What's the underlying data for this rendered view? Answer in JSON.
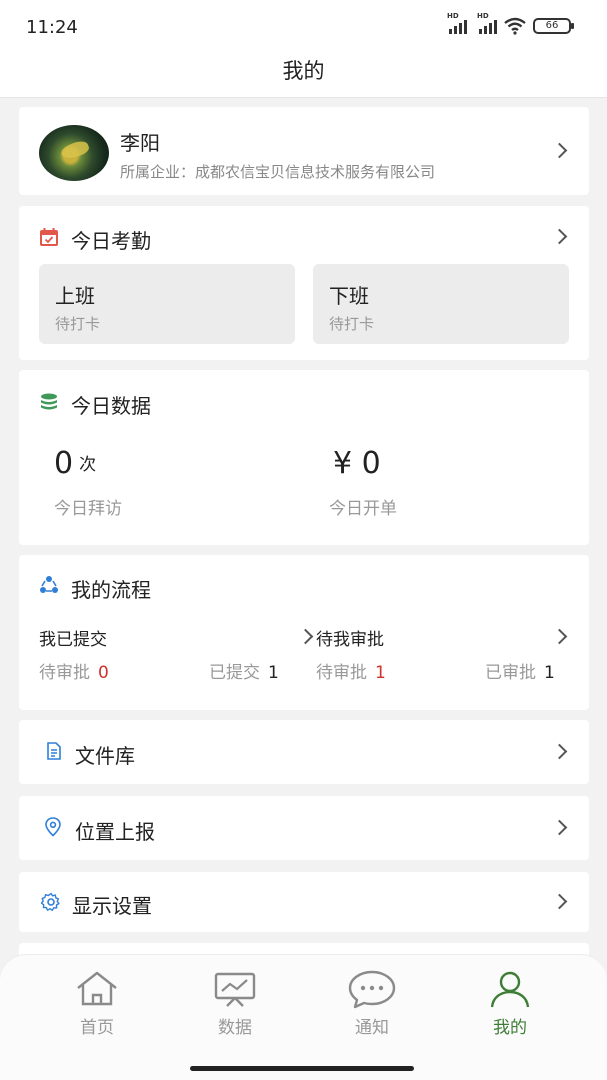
{
  "status_bar": {
    "time": "11:24",
    "signal1_label": "HD",
    "signal2_label": "HD",
    "battery": "66"
  },
  "nav": {
    "title": "我的"
  },
  "profile": {
    "name": "李阳",
    "company": "所属企业：成都农信宝贝信息技术服务有限公司"
  },
  "attendance": {
    "title": "今日考勤",
    "on_duty": {
      "title": "上班",
      "status": "待打卡"
    },
    "off_duty": {
      "title": "下班",
      "status": "待打卡"
    }
  },
  "today_data": {
    "title": "今日数据",
    "visits": {
      "value": "0",
      "unit": "次",
      "label": "今日拜访"
    },
    "orders": {
      "value": "¥ 0",
      "label": "今日开单"
    }
  },
  "process": {
    "title": "我的流程",
    "submitted": {
      "title": "我已提交",
      "pending_label": "待审批",
      "pending_value": "0",
      "done_label": "已提交",
      "done_value": "1"
    },
    "to_approve": {
      "title": "待我审批",
      "pending_label": "待审批",
      "pending_value": "1",
      "done_label": "已审批",
      "done_value": "1"
    }
  },
  "menu": {
    "files": "文件库",
    "location": "位置上报",
    "display": "显示设置"
  },
  "tabs": [
    {
      "label": "首页",
      "icon": "home-icon"
    },
    {
      "label": "数据",
      "icon": "chart-board-icon"
    },
    {
      "label": "通知",
      "icon": "chat-bubble-icon"
    },
    {
      "label": "我的",
      "icon": "user-icon"
    }
  ],
  "colors": {
    "accent": "#3e7d36",
    "alert": "#d0332e",
    "calendar": "#e2574c",
    "data_icon": "#3f9a5a",
    "link_icon": "#2f7fd8"
  }
}
